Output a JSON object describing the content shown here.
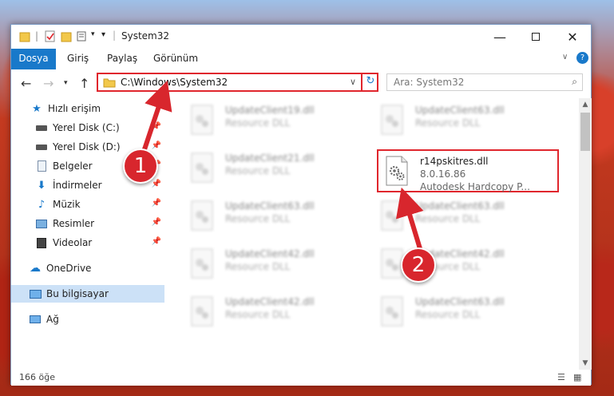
{
  "window": {
    "title": "System32"
  },
  "ribbon": {
    "tabs": [
      "Dosya",
      "Giriş",
      "Paylaş",
      "Görünüm"
    ]
  },
  "address": {
    "path": "C:\\Windows\\System32"
  },
  "search": {
    "placeholder": "Ara: System32"
  },
  "sidebar": {
    "items": [
      {
        "label": "Hızlı erişim",
        "icon": "star-icon"
      },
      {
        "label": "Yerel Disk (C:)",
        "icon": "drive-icon"
      },
      {
        "label": "Yerel Disk (D:)",
        "icon": "drive-icon"
      },
      {
        "label": "Belgeler",
        "icon": "documents-icon"
      },
      {
        "label": "İndirmeler",
        "icon": "download-icon"
      },
      {
        "label": "Müzik",
        "icon": "music-icon"
      },
      {
        "label": "Resimler",
        "icon": "pictures-icon"
      },
      {
        "label": "Videolar",
        "icon": "video-icon"
      },
      {
        "label": "OneDrive",
        "icon": "cloud-icon"
      },
      {
        "label": "Bu bilgisayar",
        "icon": "computer-icon"
      },
      {
        "label": "Ağ",
        "icon": "network-icon"
      }
    ]
  },
  "files": [
    {
      "name": "UpdateClient19.dll",
      "desc": "Resource DLL"
    },
    {
      "name": "UpdateClient63.dll",
      "desc": "Resource DLL"
    },
    {
      "name": "UpdateClient21.dll",
      "desc": "Resource DLL"
    },
    {
      "name": "UpdateClient63.dll",
      "desc": "Resource DLL"
    },
    {
      "name": "UpdateClient63.dll",
      "desc": "Resource DLL"
    },
    {
      "name": "UpdateClient42.dll",
      "desc": "Resource DLL"
    },
    {
      "name": "UpdateClient42.dll",
      "desc": "Resource DLL"
    },
    {
      "name": "UpdateClient42.dll",
      "desc": "Resource DLL"
    },
    {
      "name": "UpdateClient63.dll",
      "desc": "Resource DLL"
    }
  ],
  "highlighted_file": {
    "name": "r14pskitres.dll",
    "version": "8.0.16.86",
    "company": "Autodesk Hardcopy P..."
  },
  "status": {
    "count": "166 öğe"
  },
  "annotations": {
    "badge1": "1",
    "badge2": "2",
    "color": "#d8262d"
  }
}
